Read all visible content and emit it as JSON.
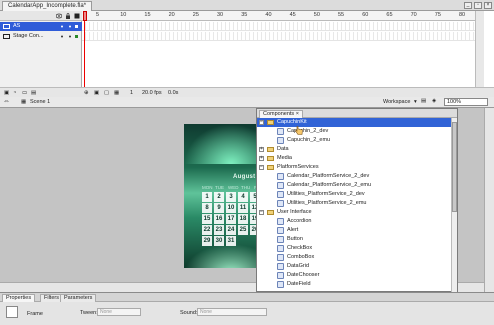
{
  "document": {
    "tab_title": "CalendarApp_Incomplete.fla*"
  },
  "timeline": {
    "layers": [
      {
        "name": "AS",
        "selected": true
      },
      {
        "name": "Stage Con...",
        "selected": false
      }
    ],
    "ruler_numbers": [
      "5",
      "10",
      "15",
      "20",
      "25",
      "30",
      "35",
      "40",
      "45",
      "50",
      "55",
      "60",
      "65",
      "70",
      "75",
      "80"
    ],
    "footer": {
      "frame": "1",
      "fps": "20.0 fps",
      "time": "0.0s"
    }
  },
  "edit_bar": {
    "scene_label": "Scene 1",
    "workspace_label": "Workspace",
    "zoom_value": "100%"
  },
  "calendar_app": {
    "title": "August 2006",
    "day_headers": [
      "MON",
      "TUE",
      "WED",
      "THU",
      "FRI"
    ],
    "dates": [
      "1",
      "2",
      "3",
      "4",
      "5",
      "8",
      "9",
      "10",
      "11",
      "12",
      "15",
      "16",
      "17",
      "18",
      "19",
      "22",
      "23",
      "24",
      "25",
      "26",
      "29",
      "30",
      "31"
    ]
  },
  "components_panel": {
    "tab_label": "Components",
    "items": [
      {
        "label": "CapuchinKit",
        "level": 0,
        "type": "folder",
        "expanded": true,
        "selected": true
      },
      {
        "label": "Capuchin_2_dev",
        "level": 1,
        "type": "component",
        "selected": false
      },
      {
        "label": "Capuchin_2_emu",
        "level": 1,
        "type": "component",
        "selected": false
      },
      {
        "label": "Data",
        "level": 0,
        "type": "folder",
        "expanded": false,
        "selected": false
      },
      {
        "label": "Media",
        "level": 0,
        "type": "folder",
        "expanded": false,
        "selected": false
      },
      {
        "label": "PlatformServices",
        "level": 0,
        "type": "folder",
        "expanded": true,
        "selected": false
      },
      {
        "label": "Calendar_PlatformService_2_dev",
        "level": 1,
        "type": "component",
        "selected": false
      },
      {
        "label": "Calendar_PlatformService_2_emu",
        "level": 1,
        "type": "component",
        "selected": false
      },
      {
        "label": "Utilities_PlatformService_2_dev",
        "level": 1,
        "type": "component",
        "selected": false
      },
      {
        "label": "Utilities_PlatformService_2_emu",
        "level": 1,
        "type": "component",
        "selected": false
      },
      {
        "label": "User Interface",
        "level": 0,
        "type": "folder",
        "expanded": true,
        "selected": false
      },
      {
        "label": "Accordion",
        "level": 1,
        "type": "component",
        "selected": false
      },
      {
        "label": "Alert",
        "level": 1,
        "type": "component",
        "selected": false
      },
      {
        "label": "Button",
        "level": 1,
        "type": "component",
        "selected": false
      },
      {
        "label": "CheckBox",
        "level": 1,
        "type": "component",
        "selected": false
      },
      {
        "label": "ComboBox",
        "level": 1,
        "type": "component",
        "selected": false
      },
      {
        "label": "DataGrid",
        "level": 1,
        "type": "component",
        "selected": false
      },
      {
        "label": "DateChooser",
        "level": 1,
        "type": "component",
        "selected": false
      },
      {
        "label": "DateField",
        "level": 1,
        "type": "component",
        "selected": false
      }
    ]
  },
  "properties_panel": {
    "tabs": [
      "Properties",
      "Filters",
      "Parameters"
    ],
    "frame_label": "Frame",
    "tween_label": "Tween:",
    "tween_value": "None",
    "sound_label": "Sound:",
    "sound_value": "None"
  },
  "colors": {
    "selection": "#3163d6",
    "playhead": "#e00000",
    "stage": "#c4c4c4"
  },
  "icons": [
    "eye-icon",
    "lock-icon",
    "outline-icon",
    "layer-icon",
    "scene-icon",
    "folder-icon",
    "component-icon",
    "close-icon",
    "hand-cursor-icon"
  ]
}
